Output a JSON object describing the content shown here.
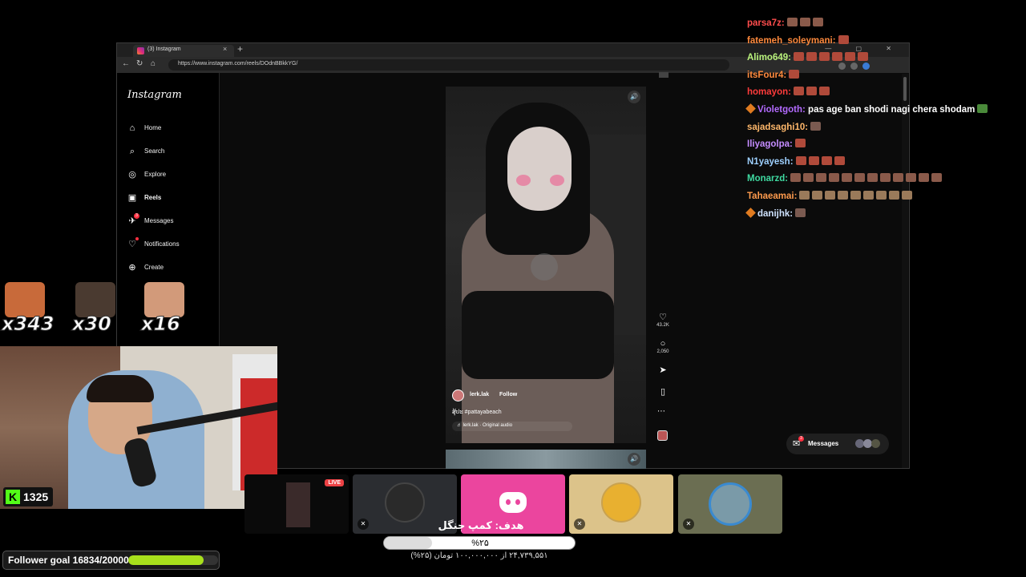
{
  "browser": {
    "tab_title": "(3) Instagram",
    "tab_close": "×",
    "new_tab": "+",
    "window_controls": "— ▢ ✕",
    "url": "https://www.instagram.com/reels/DOdnBBkkYG/",
    "nav": {
      "back": "←",
      "reload": "↻",
      "home": "⌂"
    }
  },
  "instagram": {
    "logo": "Instagram",
    "nav_items": [
      {
        "label": "Home",
        "icon": "⌂"
      },
      {
        "label": "Search",
        "icon": "⌕"
      },
      {
        "label": "Explore",
        "icon": "◎"
      },
      {
        "label": "Reels",
        "icon": "▣"
      },
      {
        "label": "Messages",
        "icon": "✈",
        "badge": "3"
      },
      {
        "label": "Notifications",
        "icon": "♡"
      },
      {
        "label": "Create",
        "icon": "⊕"
      }
    ],
    "reel": {
      "username": "lerk.lak",
      "follow": "Follow",
      "caption": "ສຸ້ປະ #pattayabeach",
      "audio": "♬ lerk.lak · Original audio",
      "likes": "43.2K",
      "comments": "2,050"
    },
    "messages_pill": {
      "label": "Messages",
      "badge": "3"
    }
  },
  "chat": [
    {
      "user": "parsa7z:",
      "color": "#ff4d4d",
      "emotes": 3,
      "emote_color": "#8a5a4a"
    },
    {
      "user": "fatemeh_soleymani:",
      "color": "#ff8a3d",
      "emotes": 1,
      "emote_color": "#b04a3a"
    },
    {
      "user": "Alimo649:",
      "color": "#b9f27c",
      "emotes": 6,
      "emote_color": "#b04a3a"
    },
    {
      "user": "itsFour4:",
      "color": "#ff8a3d",
      "emotes": 1,
      "emote_color": "#b04a3a"
    },
    {
      "user": "homayon:",
      "color": "#ff3b3b",
      "emotes": 3,
      "emote_color": "#b04a3a"
    },
    {
      "user": "Violetgoth:",
      "color": "#b36bff",
      "msg": " pas age ban shodi nagi chera shodam",
      "badge": true,
      "emotes": 1,
      "emote_color": "#4a8a3a"
    },
    {
      "user": "sajadsaghi10:",
      "color": "#ffb86b",
      "emotes": 1,
      "emote_color": "#7a5a50"
    },
    {
      "user": "Iliyagolpa:",
      "color": "#c48cff",
      "emotes": 1,
      "emote_color": "#b04a3a"
    },
    {
      "user": "N1yayesh:",
      "color": "#9ed0ff",
      "emotes": 4,
      "emote_color": "#b04a3a"
    },
    {
      "user": "Monarzd:",
      "color": "#3fd9a0",
      "emotes": 12,
      "emote_color": "#8a5a4a"
    },
    {
      "user": "Tahaeamai:",
      "color": "#ff9b4d",
      "emotes": 9,
      "emote_color": "#9a7a5a"
    },
    {
      "user": "danijhk:",
      "color": "#cfe3ff",
      "badge": true,
      "emotes": 1,
      "emote_color": "#7a5a50"
    }
  ],
  "emote_counters": [
    {
      "count": "x343",
      "color": "#c86a3a"
    },
    {
      "count": "x30",
      "color": "#4a3a30"
    },
    {
      "count": "x16",
      "color": "#d29a7a"
    }
  ],
  "kick": {
    "logo": "K",
    "count": "1325"
  },
  "follower_goal": {
    "label": "Follower goal 16834/20000",
    "progress": 0.8417
  },
  "discord": {
    "live_label": "LIVE"
  },
  "donation_goal": {
    "title": "هدف: کمپ جنگل",
    "percent_label": "%۲۵",
    "progress": 0.25,
    "amount": "۲۴,۷۳۹,۵۵۱ از ۱۰۰,۰۰۰,۰۰۰ تومان (۲۵%)"
  }
}
